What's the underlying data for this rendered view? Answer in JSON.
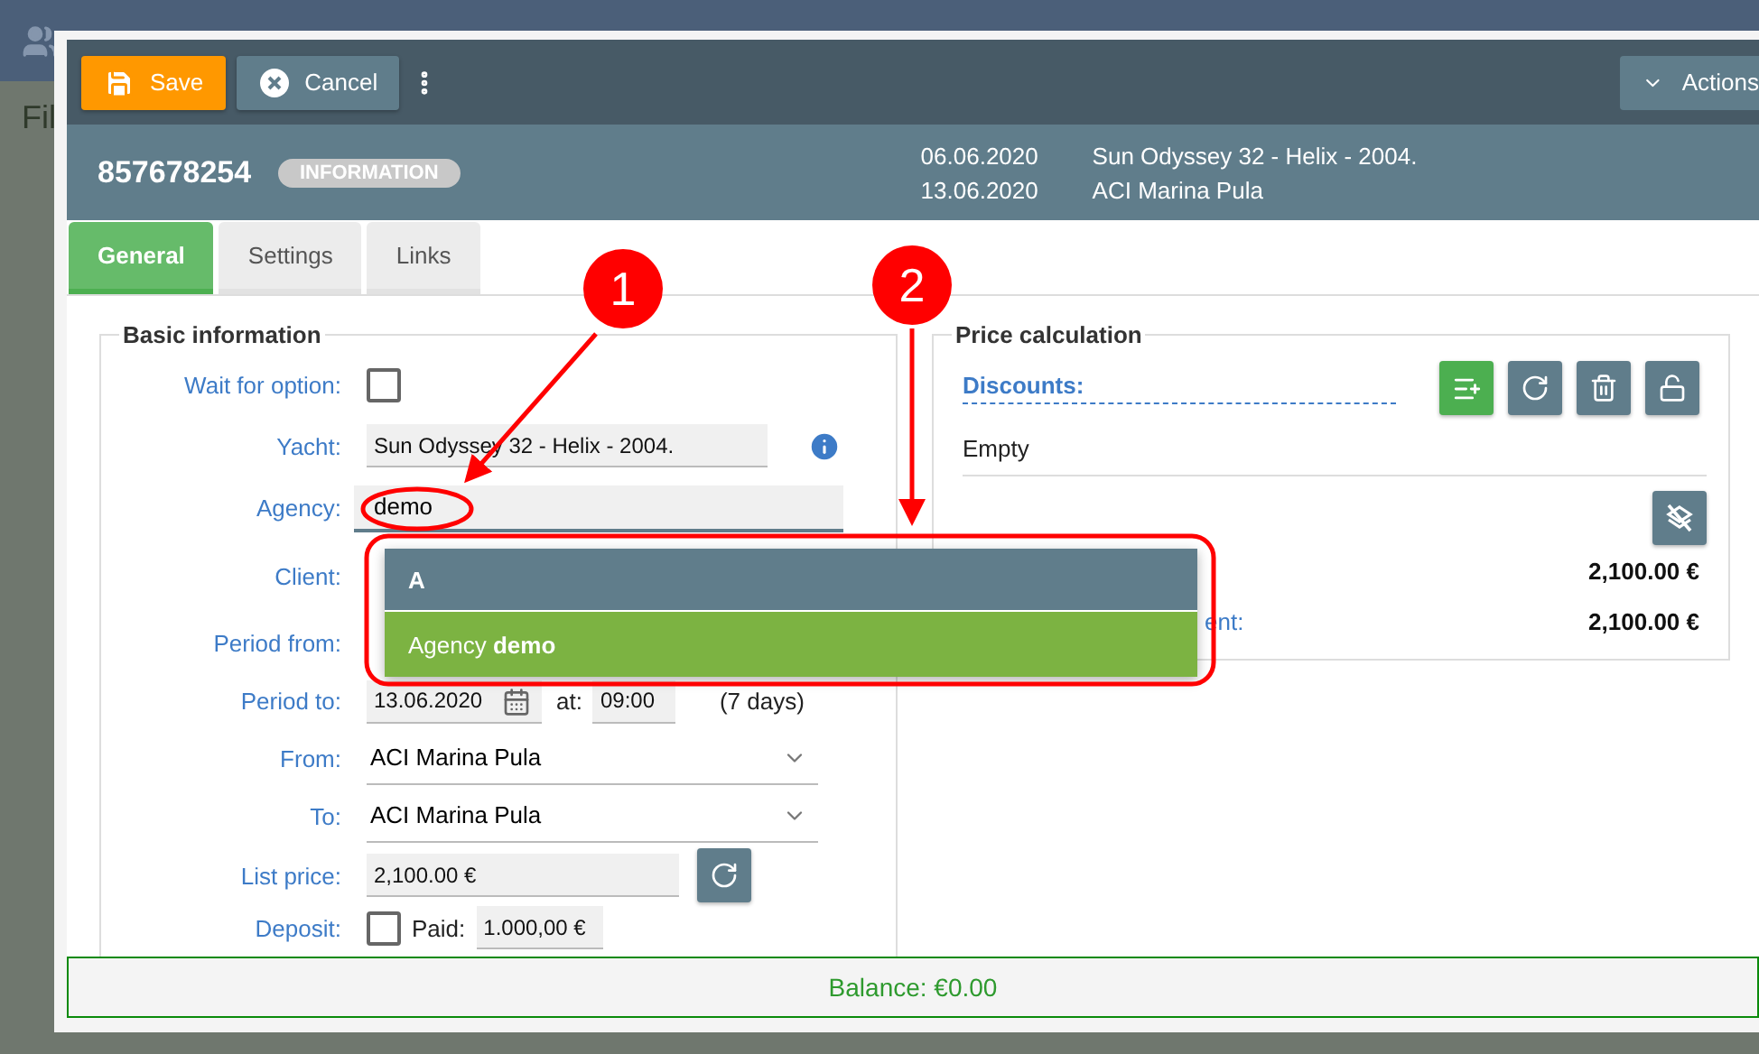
{
  "background": {
    "sidebar_text": "Fil"
  },
  "toolbar": {
    "buttons": [
      {
        "label": "Save",
        "kind": "save"
      },
      {
        "label": "Cancel",
        "kind": "cancel"
      }
    ],
    "actions": "Actions"
  },
  "header": {
    "number": "857678254",
    "badge": "INFORMATION",
    "dates": [
      "06.06.2020",
      "13.06.2020"
    ],
    "details": [
      "Sun Odyssey 32 - Helix - 2004.",
      "ACI Marina Pula"
    ]
  },
  "tabs": [
    {
      "label": "General",
      "selected": true
    },
    {
      "label": "Settings",
      "selected": false
    },
    {
      "label": "Links",
      "selected": false
    }
  ],
  "basic_information": {
    "title": "Basic information",
    "rows": [
      {
        "kind": "checkbox",
        "label": "Wait for option:",
        "checked": false
      },
      {
        "kind": "readonly_info",
        "label": "Yacht:",
        "value": "Sun Odyssey 32 - Helix - 2004."
      },
      {
        "kind": "input",
        "label": "Agency:",
        "value": "demo"
      },
      {
        "kind": "covered",
        "label": "Client:"
      },
      {
        "kind": "covered_short",
        "label": "Period from:"
      },
      {
        "kind": "date",
        "label": "Period to:",
        "value": "13.06.2020",
        "at_label": "at:",
        "time": "09:00",
        "note": "(7 days)"
      },
      {
        "kind": "select",
        "label": "From:",
        "value": "ACI Marina Pula"
      },
      {
        "kind": "select",
        "label": "To:",
        "value": "ACI Marina Pula"
      },
      {
        "kind": "price",
        "label": "List price:",
        "value": "2,100.00 €"
      },
      {
        "kind": "deposit",
        "label": "Deposit:",
        "checked": false,
        "paid_label": "Paid:",
        "value": "1.000,00 €"
      }
    ]
  },
  "price_calculation": {
    "title": "Price calculation",
    "discounts_label": "Discounts:",
    "empty_text": "Empty",
    "totals": [
      {
        "value": "2,100.00 €"
      },
      {
        "label": "ent:",
        "value": "2,100.00 €"
      }
    ]
  },
  "dropdown": {
    "header": "A",
    "items": [
      {
        "text": "Agency **demo**",
        "selected": true
      }
    ]
  },
  "annotations": [
    {
      "number": "1"
    },
    {
      "number": "2"
    }
  ],
  "footer": {
    "balance": "Balance: €0.00"
  }
}
